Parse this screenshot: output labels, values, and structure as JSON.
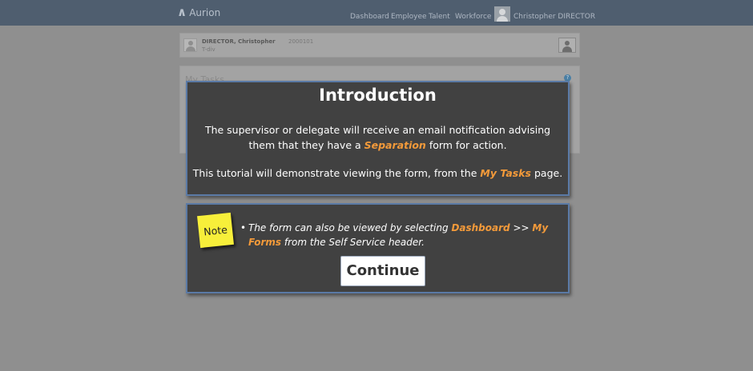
{
  "app": {
    "logo_text": "Aurion",
    "nav": [
      "Dashboard",
      "Employee",
      "Talent",
      "Workforce"
    ],
    "user_name": "Christopher DIRECTOR"
  },
  "profile": {
    "name": "DIRECTOR, Christopher",
    "id": "2000101",
    "subtitle": "T-div"
  },
  "tasks_panel": {
    "title": "My Tasks"
  },
  "intro": {
    "title": "Introduction",
    "p1_before": "The supervisor or delegate will receive an email notification advising them that they have a ",
    "p1_highlight": "Separation",
    "p1_after": " form for action.",
    "p2_before": "This tutorial will demonstrate viewing the form, from the ",
    "p2_highlight": "My Tasks",
    "p2_after": " page."
  },
  "note": {
    "sticky_label": "Note",
    "bullet": "•",
    "text_before": "The form can also be viewed by selecting ",
    "hl1": "Dashboard",
    "sep": " >> ",
    "hl2": "My Forms",
    "text_after": " from the Self Service header.",
    "continue_label": "Continue"
  },
  "colors": {
    "highlight": "#f39a3a",
    "dialog_bg": "#414141",
    "dialog_border": "#5b7aa6",
    "sticky": "#f7ef3a"
  }
}
